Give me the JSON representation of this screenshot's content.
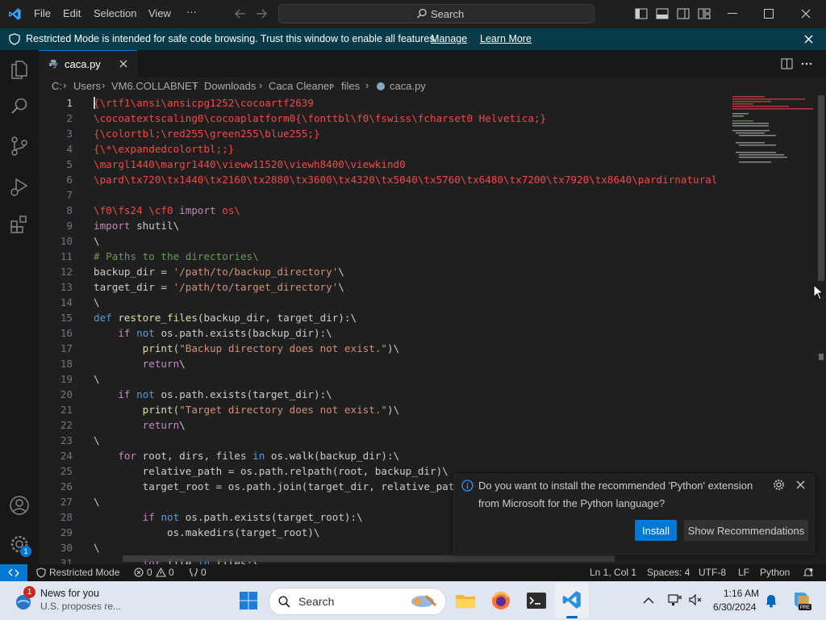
{
  "titlebar": {
    "menu": [
      "File",
      "Edit",
      "Selection",
      "View"
    ],
    "more": "···",
    "search_label": "Search"
  },
  "banner": {
    "text": "Restricted Mode is intended for safe code browsing. Trust this window to enable all features.",
    "manage": "Manage",
    "learn_more": "Learn More"
  },
  "activity": {
    "account_badge": "1"
  },
  "tab": {
    "label": "caca.py"
  },
  "breadcrumb": [
    "C:",
    "Users",
    "VM6.COLLABNET",
    "Downloads",
    "Caca Cleaner",
    "files",
    "caca.py"
  ],
  "editor": {
    "lines": [
      {
        "n": "1",
        "cls": "c-red",
        "t": "{\\rtf1\\ansi\\ansicpg1252\\cocoartf2639"
      },
      {
        "n": "2",
        "cls": "c-red",
        "t": "\\cocoatextscaling0\\cocoaplatform0{\\fonttbl\\f0\\fswiss\\fcharset0 Helvetica;}"
      },
      {
        "n": "3",
        "cls": "c-red",
        "t": "{\\colortbl;\\red255\\green255\\blue255;}"
      },
      {
        "n": "4",
        "cls": "c-red",
        "t": "{\\*\\expandedcolortbl;;}"
      },
      {
        "n": "5",
        "cls": "c-red",
        "t": "\\margl1440\\margr1440\\vieww11520\\viewh8400\\viewkind0"
      },
      {
        "n": "6",
        "cls": "c-red",
        "t": "\\pard\\tx720\\tx1440\\tx2160\\tx2880\\tx3600\\tx4320\\tx5040\\tx5760\\tx6480\\tx7200\\tx7920\\tx8640\\pardirnatural"
      },
      {
        "n": "7",
        "cls": "c-plain",
        "t": ""
      },
      {
        "n": "8",
        "cls": "c-red",
        "t": "\\f0\\fs24 \\cf0 import os\\"
      },
      {
        "n": "9",
        "cls": "c-plain",
        "t": "import shutil\\"
      },
      {
        "n": "10",
        "cls": "c-plain",
        "t": "\\"
      },
      {
        "n": "11",
        "cls": "c-com",
        "t": "# Paths to the directories\\"
      },
      {
        "n": "12",
        "cls": "c-plain",
        "t": "backup_dir = '/path/to/backup_directory'\\"
      },
      {
        "n": "13",
        "cls": "c-plain",
        "t": "target_dir = '/path/to/target_directory'\\"
      },
      {
        "n": "14",
        "cls": "c-plain",
        "t": "\\"
      },
      {
        "n": "15",
        "cls": "c-plain",
        "t": "def restore_files(backup_dir, target_dir):\\"
      },
      {
        "n": "16",
        "cls": "c-plain",
        "t": "    if not os.path.exists(backup_dir):\\"
      },
      {
        "n": "17",
        "cls": "c-plain",
        "t": "        print(\"Backup directory does not exist.\")\\"
      },
      {
        "n": "18",
        "cls": "c-plain",
        "t": "        return\\"
      },
      {
        "n": "19",
        "cls": "c-plain",
        "t": "\\"
      },
      {
        "n": "20",
        "cls": "c-plain",
        "t": "    if not os.path.exists(target_dir):\\"
      },
      {
        "n": "21",
        "cls": "c-plain",
        "t": "        print(\"Target directory does not exist.\")\\"
      },
      {
        "n": "22",
        "cls": "c-plain",
        "t": "        return\\"
      },
      {
        "n": "23",
        "cls": "c-plain",
        "t": "\\"
      },
      {
        "n": "24",
        "cls": "c-plain",
        "t": "    for root, dirs, files in os.walk(backup_dir):\\"
      },
      {
        "n": "25",
        "cls": "c-plain",
        "t": "        relative_path = os.path.relpath(root, backup_dir)\\"
      },
      {
        "n": "26",
        "cls": "c-plain",
        "t": "        target_root = os.path.join(target_dir, relative_path)\\"
      },
      {
        "n": "27",
        "cls": "c-plain",
        "t": "\\"
      },
      {
        "n": "28",
        "cls": "c-plain",
        "t": "        if not os.path.exists(target_root):\\"
      },
      {
        "n": "29",
        "cls": "c-plain",
        "t": "            os.makedirs(target_root)\\"
      },
      {
        "n": "30",
        "cls": "c-plain",
        "t": "\\"
      },
      {
        "n": "31",
        "cls": "c-plain",
        "t": "        for file in files:\\"
      }
    ]
  },
  "notification": {
    "message_line1": "Do you want to install the recommended 'Python' extension",
    "message_line2": "from Microsoft for the Python language?",
    "install": "Install",
    "show_recommendations": "Show Recommendations"
  },
  "statusbar": {
    "restricted": "Restricted Mode",
    "errors": "0",
    "warnings": "0",
    "ports": "0",
    "position": "Ln 1, Col 1",
    "spaces": "Spaces: 4",
    "encoding": "UTF-8",
    "eol": "LF",
    "language": "Python"
  },
  "taskbar": {
    "news_title": "News for you",
    "news_sub": "U.S. proposes re...",
    "news_badge": "1",
    "search": "Search",
    "time": "1:16 AM",
    "date": "6/30/2024"
  },
  "colors": {
    "accent": "#0078d4",
    "banner_bg": "#063b49",
    "install_button": "#0078d4",
    "rtf_red": "#f44747"
  }
}
